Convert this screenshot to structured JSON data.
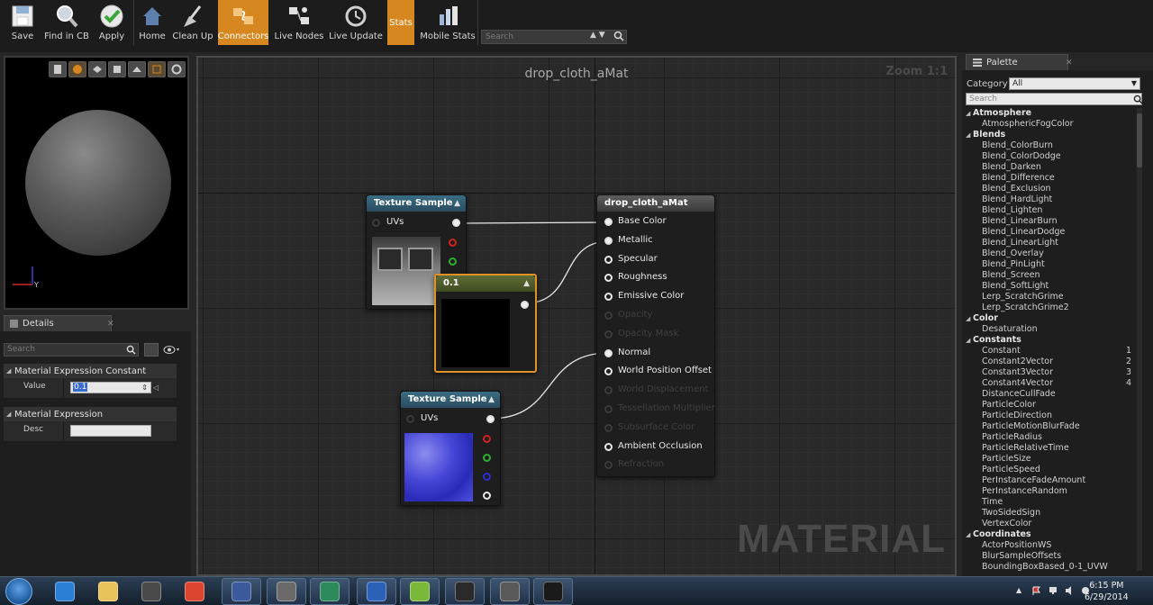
{
  "toolbar": {
    "buttons": [
      {
        "label": "Save",
        "icon": "save-icon"
      },
      {
        "label": "Find in CB",
        "icon": "find-icon"
      },
      {
        "label": "Apply",
        "icon": "checkmark-icon"
      },
      {
        "label": "Home",
        "icon": "home-icon"
      },
      {
        "label": "Clean Up",
        "icon": "broom-icon"
      },
      {
        "label": "Connectors",
        "icon": "connectors-icon",
        "active": true
      },
      {
        "label": "Live Nodes",
        "icon": "live-nodes-icon"
      },
      {
        "label": "Live Update",
        "icon": "live-update-icon"
      },
      {
        "label": "Stats",
        "icon": "stats-icon",
        "active": true
      },
      {
        "label": "Mobile Stats",
        "icon": "mobile-stats-icon"
      }
    ],
    "search_placeholder": "Search"
  },
  "details": {
    "tab_label": "Details",
    "search_placeholder": "Search",
    "section1": "Material Expression Constant",
    "value_label": "Value",
    "value": "0.1",
    "section2": "Material Expression",
    "desc_label": "Desc",
    "desc_value": ""
  },
  "graph": {
    "title": "drop_cloth_aMat",
    "zoom": "Zoom 1:1",
    "watermark": "MATERIAL",
    "nodes": {
      "tex1": {
        "title": "Texture Sample",
        "input": "UVs"
      },
      "const": {
        "title": "0.1"
      },
      "tex2": {
        "title": "Texture Sample",
        "input": "UVs"
      },
      "mat": {
        "title": "drop_cloth_aMat",
        "pins": [
          {
            "label": "Base Color",
            "enabled": true,
            "connected": true
          },
          {
            "label": "Metallic",
            "enabled": true,
            "connected": true
          },
          {
            "label": "Specular",
            "enabled": true,
            "connected": false
          },
          {
            "label": "Roughness",
            "enabled": true,
            "connected": false
          },
          {
            "label": "Emissive Color",
            "enabled": true,
            "connected": false
          },
          {
            "label": "Opacity",
            "enabled": false,
            "connected": false
          },
          {
            "label": "Opacity Mask",
            "enabled": false,
            "connected": false
          },
          {
            "label": "Normal",
            "enabled": true,
            "connected": true
          },
          {
            "label": "World Position Offset",
            "enabled": true,
            "connected": false
          },
          {
            "label": "World Displacement",
            "enabled": false,
            "connected": false
          },
          {
            "label": "Tessellation Multiplier",
            "enabled": false,
            "connected": false
          },
          {
            "label": "Subsurface Color",
            "enabled": false,
            "connected": false
          },
          {
            "label": "Ambient Occlusion",
            "enabled": true,
            "connected": false
          },
          {
            "label": "Refraction",
            "enabled": false,
            "connected": false
          }
        ]
      }
    }
  },
  "palette": {
    "tab_label": "Palette",
    "category_label": "Category",
    "category_value": "All",
    "search_placeholder": "Search",
    "items": [
      {
        "type": "header",
        "label": "Atmosphere"
      },
      {
        "type": "leaf",
        "label": "AtmosphericFogColor"
      },
      {
        "type": "header",
        "label": "Blends"
      },
      {
        "type": "leaf",
        "label": "Blend_ColorBurn"
      },
      {
        "type": "leaf",
        "label": "Blend_ColorDodge"
      },
      {
        "type": "leaf",
        "label": "Blend_Darken"
      },
      {
        "type": "leaf",
        "label": "Blend_Difference"
      },
      {
        "type": "leaf",
        "label": "Blend_Exclusion"
      },
      {
        "type": "leaf",
        "label": "Blend_HardLight"
      },
      {
        "type": "leaf",
        "label": "Blend_Lighten"
      },
      {
        "type": "leaf",
        "label": "Blend_LinearBurn"
      },
      {
        "type": "leaf",
        "label": "Blend_LinearDodge"
      },
      {
        "type": "leaf",
        "label": "Blend_LinearLight"
      },
      {
        "type": "leaf",
        "label": "Blend_Overlay"
      },
      {
        "type": "leaf",
        "label": "Blend_PinLight"
      },
      {
        "type": "leaf",
        "label": "Blend_Screen"
      },
      {
        "type": "leaf",
        "label": "Blend_SoftLight"
      },
      {
        "type": "leaf",
        "label": "Lerp_ScratchGrime"
      },
      {
        "type": "leaf",
        "label": "Lerp_ScratchGrime2"
      },
      {
        "type": "header",
        "label": "Color"
      },
      {
        "type": "leaf",
        "label": "Desaturation"
      },
      {
        "type": "header",
        "label": "Constants"
      },
      {
        "type": "leaf",
        "label": "Constant",
        "hotkey": "1"
      },
      {
        "type": "leaf",
        "label": "Constant2Vector",
        "hotkey": "2"
      },
      {
        "type": "leaf",
        "label": "Constant3Vector",
        "hotkey": "3"
      },
      {
        "type": "leaf",
        "label": "Constant4Vector",
        "hotkey": "4"
      },
      {
        "type": "leaf",
        "label": "DistanceCullFade"
      },
      {
        "type": "leaf",
        "label": "ParticleColor"
      },
      {
        "type": "leaf",
        "label": "ParticleDirection"
      },
      {
        "type": "leaf",
        "label": "ParticleMotionBlurFade"
      },
      {
        "type": "leaf",
        "label": "ParticleRadius"
      },
      {
        "type": "leaf",
        "label": "ParticleRelativeTime"
      },
      {
        "type": "leaf",
        "label": "ParticleSize"
      },
      {
        "type": "leaf",
        "label": "ParticleSpeed"
      },
      {
        "type": "leaf",
        "label": "PerInstanceFadeAmount"
      },
      {
        "type": "leaf",
        "label": "PerInstanceRandom"
      },
      {
        "type": "leaf",
        "label": "Time"
      },
      {
        "type": "leaf",
        "label": "TwoSidedSign"
      },
      {
        "type": "leaf",
        "label": "VertexColor"
      },
      {
        "type": "header",
        "label": "Coordinates"
      },
      {
        "type": "leaf",
        "label": "ActorPositionWS"
      },
      {
        "type": "leaf",
        "label": "BlurSampleOffsets"
      },
      {
        "type": "leaf",
        "label": "BoundingBoxBased_0-1_UVW"
      }
    ]
  },
  "taskbar": {
    "apps": [
      "internet-explorer-icon",
      "file-explorer-icon",
      "media-player-icon",
      "chrome-icon",
      "maya-icon",
      "app-icon",
      "terminal-icon",
      "photoshop-icon",
      "xnormal-icon",
      "unreal-icon",
      "app2-icon",
      "unreal-editor-icon"
    ],
    "time": "6:15 PM",
    "date": "6/29/2014"
  }
}
